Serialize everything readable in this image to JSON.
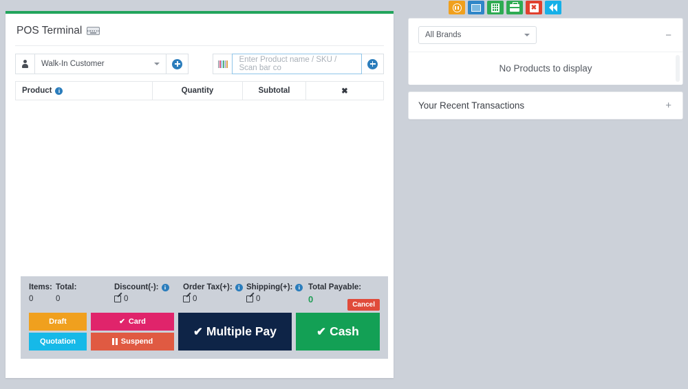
{
  "left_panel": {
    "title": "POS Terminal",
    "title_icon": "keyboard-icon",
    "customer": {
      "icon": "person-icon",
      "value": "Walk-In Customer",
      "add_icon": "plus-circle-icon"
    },
    "product": {
      "icon": "barcode-icon",
      "placeholder": "Enter Product name / SKU / Scan bar co",
      "value": "",
      "add_icon": "plus-circle-icon"
    },
    "table": {
      "columns": [
        "Product",
        "Quantity",
        "Subtotal",
        "✖"
      ],
      "product_info_icon": "info-icon",
      "rows": []
    },
    "summary": {
      "items_label": "Items:",
      "items_value": "0",
      "total_label": "Total:",
      "total_value": "0",
      "discount_label": "Discount(-):",
      "discount_value": "0",
      "order_tax_label": "Order Tax(+):",
      "order_tax_value": "0",
      "shipping_label": "Shipping(+):",
      "shipping_value": "0",
      "total_payable_label": "Total Payable:",
      "total_payable_value": "0",
      "cancel_label": "Cancel"
    },
    "buttons": {
      "draft": "Draft",
      "quotation": "Quotation",
      "card": "Card",
      "suspend": "Suspend",
      "multiple_pay": "Multiple Pay",
      "cash": "Cash"
    }
  },
  "iconbar": [
    {
      "name": "pause-icon",
      "color": "#f0a01e"
    },
    {
      "name": "window-icon",
      "color": "#2f86c8"
    },
    {
      "name": "calculator-icon",
      "color": "#2eab53"
    },
    {
      "name": "briefcase-icon",
      "color": "#2eab53"
    },
    {
      "name": "close-icon",
      "color": "#e0402e"
    },
    {
      "name": "rewind-icon",
      "color": "#16b0e8"
    }
  ],
  "right_panel": {
    "brand_select_value": "All Brands",
    "collapse_sign": "−",
    "no_products_text": "No Products to display",
    "transactions_title": "Your Recent Transactions",
    "expand_sign": "+"
  },
  "colors": {
    "accent_green": "#22a45c",
    "page_bg": "#ccd1d9",
    "payable_green": "#1f9d55"
  }
}
